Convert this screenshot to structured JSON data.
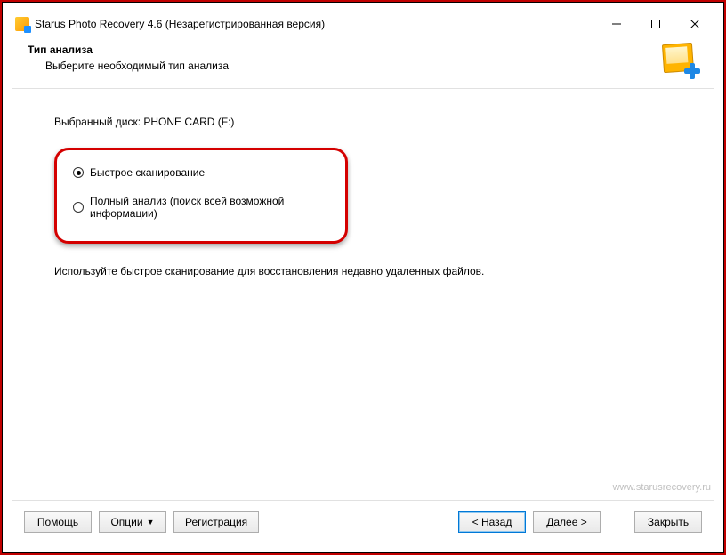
{
  "window": {
    "title": "Starus Photo Recovery 4.6 (Незарегистрированная версия)"
  },
  "header": {
    "title": "Тип анализа",
    "subtitle": "Выберите необходимый тип анализа"
  },
  "content": {
    "selected_disk_label": "Выбранный диск: PHONE CARD (F:)",
    "options": {
      "quick": "Быстрое сканирование",
      "full": "Полный анализ (поиск всей возможной информации)"
    },
    "description": "Используйте быстрое сканирование для восстановления недавно удаленных файлов."
  },
  "watermark": "www.starusrecovery.ru",
  "footer": {
    "help": "Помощь",
    "options": "Опции",
    "registration": "Регистрация",
    "back": "< Назад",
    "next": "Далее >",
    "close": "Закрыть"
  }
}
